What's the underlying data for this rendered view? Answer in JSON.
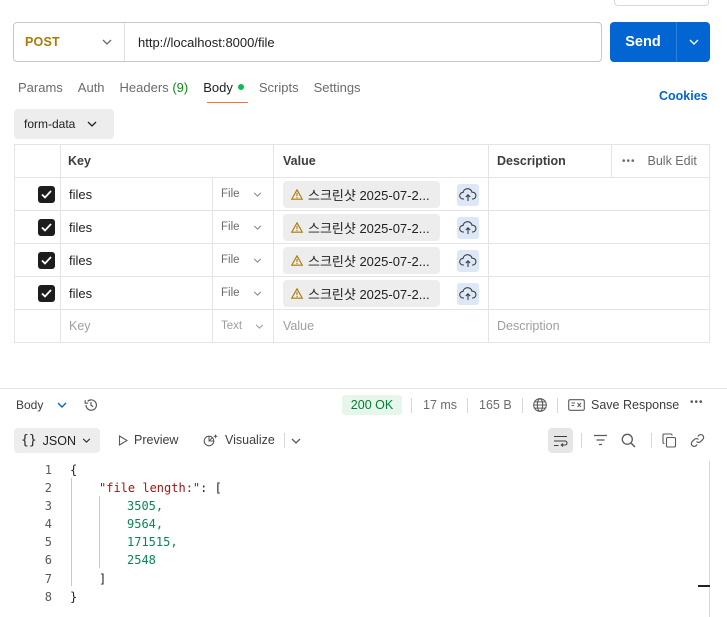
{
  "request": {
    "method": "POST",
    "url": "http://localhost:8000/file",
    "send_label": "Send"
  },
  "tabs": [
    {
      "label": "Params"
    },
    {
      "label": "Auth"
    },
    {
      "label": "Headers",
      "count": "(9)"
    },
    {
      "label": "Body"
    },
    {
      "label": "Scripts"
    },
    {
      "label": "Settings"
    }
  ],
  "cookies_label": "Cookies",
  "body_mode": "form-data",
  "table": {
    "headers": {
      "key": "Key",
      "value": "Value",
      "description": "Description",
      "bulk_edit": "Bulk Edit"
    },
    "rows": [
      {
        "key": "files",
        "type": "File",
        "file": "스크린샷 2025-07-2..."
      },
      {
        "key": "files",
        "type": "File",
        "file": "스크린샷 2025-07-2..."
      },
      {
        "key": "files",
        "type": "File",
        "file": "스크린샷 2025-07-2..."
      },
      {
        "key": "files",
        "type": "File",
        "file": "스크린샷 2025-07-2..."
      }
    ],
    "placeholder": {
      "key": "Key",
      "type": "Text",
      "value": "Value",
      "description": "Description"
    }
  },
  "response": {
    "body_label": "Body",
    "status": "200 OK",
    "time": "17 ms",
    "size": "165 B",
    "save_label": "Save Response",
    "format": "JSON",
    "preview_label": "Preview",
    "visualize_label": "Visualize",
    "line_numbers": [
      "1",
      "2",
      "3",
      "4",
      "5",
      "6",
      "7",
      "8"
    ],
    "json": {
      "open": "{",
      "key": "\"file length:\"",
      "colon_bracket": ": [",
      "values": [
        "3505,",
        "9564,",
        "171515,",
        "2548"
      ],
      "close_bracket": "]",
      "close": "}"
    }
  },
  "colors": {
    "accent": "#0265d2",
    "method": "#ad7a03",
    "status_ok": "#007f31",
    "tab_indicator": "#ff6c37",
    "body_dot": "#0cbb52"
  }
}
